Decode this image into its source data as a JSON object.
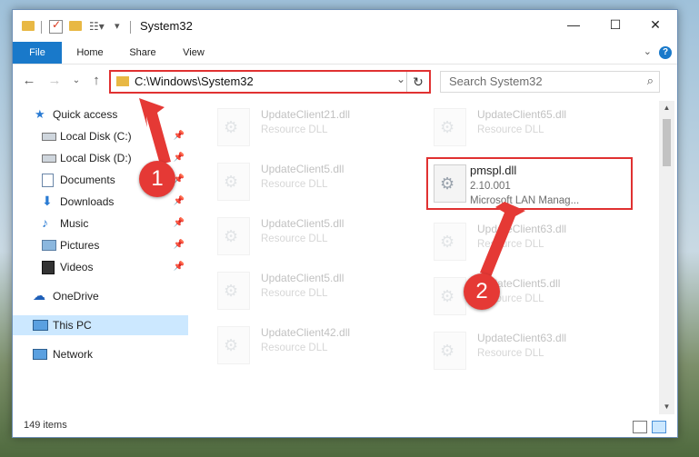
{
  "window": {
    "title": "System32",
    "controls": {
      "minimize": "—",
      "maximize": "☐",
      "close": "✕"
    }
  },
  "ribbon": {
    "tabs": [
      "File",
      "Home",
      "Share",
      "View"
    ],
    "help_icon": "help-icon",
    "help_label": "?"
  },
  "nav": {
    "address": "C:\\Windows\\System32",
    "search_placeholder": "Search System32"
  },
  "sidebar": {
    "items": [
      {
        "label": "Quick access",
        "icon": "star-icon",
        "pinned": false
      },
      {
        "label": "Local Disk (C:)",
        "icon": "drive-icon",
        "pinned": true
      },
      {
        "label": "Local Disk (D:)",
        "icon": "drive-icon",
        "pinned": true
      },
      {
        "label": "Documents",
        "icon": "documents-icon",
        "pinned": true
      },
      {
        "label": "Downloads",
        "icon": "download-icon",
        "pinned": true
      },
      {
        "label": "Music",
        "icon": "music-icon",
        "pinned": true
      },
      {
        "label": "Pictures",
        "icon": "pictures-icon",
        "pinned": true
      },
      {
        "label": "Videos",
        "icon": "videos-icon",
        "pinned": true
      },
      {
        "label": "OneDrive",
        "icon": "cloud-icon",
        "pinned": false
      },
      {
        "label": "This PC",
        "icon": "computer-icon",
        "pinned": false,
        "selected": true
      },
      {
        "label": "Network",
        "icon": "network-icon",
        "pinned": false
      }
    ]
  },
  "files": {
    "left": [
      {
        "name": "UpdateClient21.dll",
        "type": "Resource DLL"
      },
      {
        "name": "UpdateClient5.dll",
        "type": "Resource DLL"
      },
      {
        "name": "UpdateClient5.dll",
        "type": "Resource DLL"
      },
      {
        "name": "UpdateClient5.dll",
        "type": "Resource DLL"
      },
      {
        "name": "UpdateClient42.dll",
        "type": "Resource DLL"
      }
    ],
    "right": [
      {
        "name": "UpdateClient65.dll",
        "type": "Resource DLL"
      },
      {
        "name": "UpdateClient63.dll",
        "type": "Resource DLL"
      },
      {
        "name": "UpdateClient5.dll",
        "type": "Resource DLL"
      },
      {
        "name": "UpdateClient63.dll",
        "type": "Resource DLL"
      }
    ],
    "highlighted": {
      "name": "pmspl.dll",
      "version": "2.10.001",
      "description": "Microsoft LAN Manag..."
    }
  },
  "status": {
    "item_count": "149 items"
  },
  "annotations": {
    "step1": "1",
    "step2": "2",
    "accent": "#e53935"
  }
}
